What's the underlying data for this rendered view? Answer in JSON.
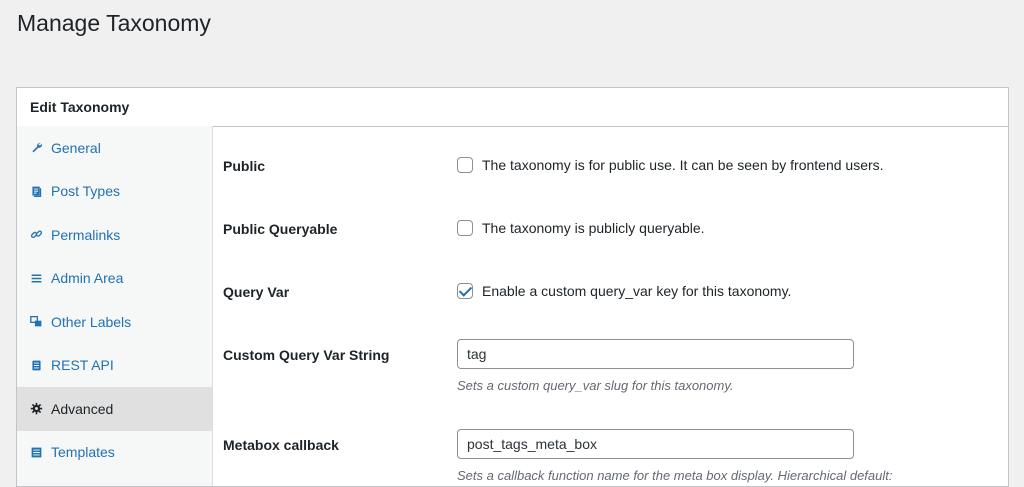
{
  "page": {
    "title": "Manage Taxonomy"
  },
  "panel": {
    "title": "Edit Taxonomy"
  },
  "sidebar": {
    "items": [
      {
        "label": "General",
        "icon": "wrench-icon",
        "active": false
      },
      {
        "label": "Post Types",
        "icon": "post-types-icon",
        "active": false
      },
      {
        "label": "Permalinks",
        "icon": "link-icon",
        "active": false
      },
      {
        "label": "Admin Area",
        "icon": "menu-icon",
        "active": false
      },
      {
        "label": "Other Labels",
        "icon": "labels-icon",
        "active": false
      },
      {
        "label": "REST API",
        "icon": "database-icon",
        "active": false
      },
      {
        "label": "Advanced",
        "icon": "gear-icon",
        "active": true
      },
      {
        "label": "Templates",
        "icon": "list-view-icon",
        "active": false
      }
    ]
  },
  "fields": {
    "public": {
      "label": "Public",
      "description": "The taxonomy is for public use. It can be seen by frontend users.",
      "checked": false
    },
    "public_queryable": {
      "label": "Public Queryable",
      "description": "The taxonomy is publicly queryable.",
      "checked": false
    },
    "query_var": {
      "label": "Query Var",
      "description": "Enable a custom query_var key for this taxonomy.",
      "checked": true
    },
    "custom_query_var": {
      "label": "Custom Query Var String",
      "value": "tag",
      "help": "Sets a custom query_var slug for this taxonomy."
    },
    "metabox_callback": {
      "label": "Metabox callback",
      "value": "post_tags_meta_box",
      "help": "Sets a callback function name for the meta box display. Hierarchical default:"
    }
  },
  "colors": {
    "link": "#2271b1",
    "background": "#f0f0f1",
    "active_nav": "#e0e0e0"
  }
}
